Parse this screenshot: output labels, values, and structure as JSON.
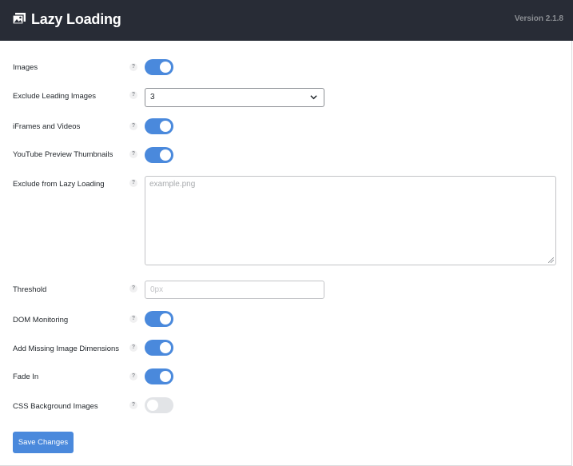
{
  "header": {
    "icon": "images-icon",
    "title": "Lazy Loading",
    "version": "Version 2.1.8"
  },
  "help_glyph": "?",
  "settings": [
    {
      "label": "Images",
      "control": "toggle",
      "on": true
    },
    {
      "label": "Exclude Leading Images",
      "control": "select",
      "value": "3"
    },
    {
      "label": "iFrames and Videos",
      "control": "toggle",
      "on": true
    },
    {
      "label": "YouTube Preview Thumbnails",
      "control": "toggle",
      "on": true
    },
    {
      "label": "Exclude from Lazy Loading",
      "control": "textarea",
      "placeholder": "example.png"
    },
    {
      "label": "Threshold",
      "control": "input",
      "placeholder": "0px"
    },
    {
      "label": "DOM Monitoring",
      "control": "toggle",
      "on": true
    },
    {
      "label": "Add Missing Image Dimensions",
      "control": "toggle",
      "on": true
    },
    {
      "label": "Fade In",
      "control": "toggle",
      "on": true
    },
    {
      "label": "CSS Background Images",
      "control": "toggle",
      "on": false
    }
  ],
  "save_label": "Save Changes",
  "colors": {
    "accent": "#4a89dc",
    "header_bg": "#282c36",
    "toggle_off": "#e2e4e7"
  }
}
